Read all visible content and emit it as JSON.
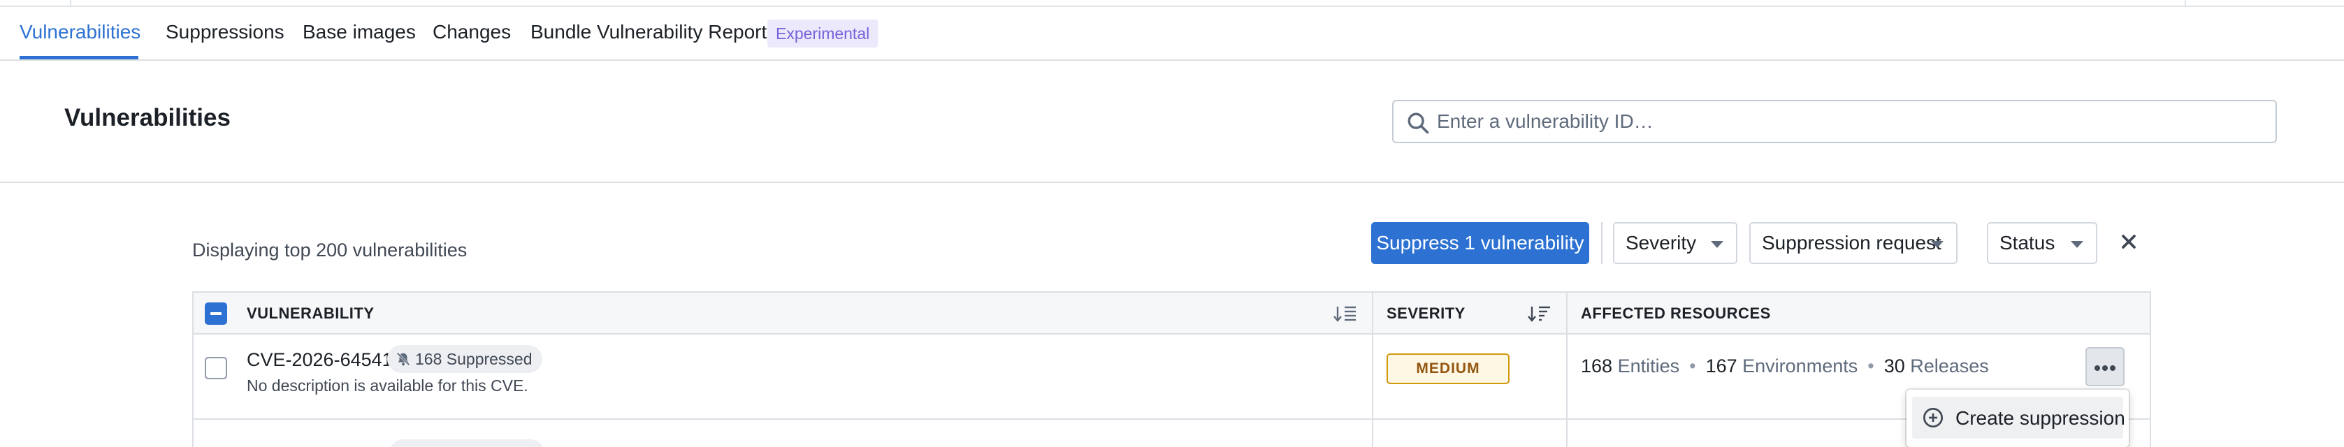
{
  "tabs": [
    {
      "label": "Vulnerabilities",
      "active": true
    },
    {
      "label": "Suppressions"
    },
    {
      "label": "Base images"
    },
    {
      "label": "Changes"
    },
    {
      "label": "Bundle Vulnerability Report"
    }
  ],
  "experimental_tag": "Experimental",
  "page": {
    "title": "Vulnerabilities",
    "search_placeholder": "Enter a vulnerability ID…"
  },
  "toolbar": {
    "displaying_text": "Displaying top 200 vulnerabilities",
    "suppress_button": "Suppress 1 vulnerability",
    "filters": {
      "severity": "Severity",
      "suppression_request": "Suppression request",
      "status": "Status"
    }
  },
  "table": {
    "headers": {
      "vulnerability": "VULNERABILITY",
      "severity": "SEVERITY",
      "affected_resources": "AFFECTED RESOURCES"
    },
    "rows": [
      {
        "cve_id": "CVE-2026-64541",
        "suppressed_count": "168 Suppressed",
        "description": "No description is available for this CVE.",
        "severity": "MEDIUM",
        "entities_count": "168",
        "entities_label": "Entities",
        "environments_count": "167",
        "environments_label": "Environments",
        "releases_count": "30",
        "releases_label": "Releases",
        "selected": false
      }
    ]
  },
  "context_menu": {
    "create_suppression": "Create suppression"
  },
  "colors": {
    "accent": "#2d72d2",
    "experimental_bg": "#ebe9fb",
    "experimental_text": "#7961db",
    "medium_severity_border": "#d1980b",
    "medium_severity_text": "#935610"
  }
}
